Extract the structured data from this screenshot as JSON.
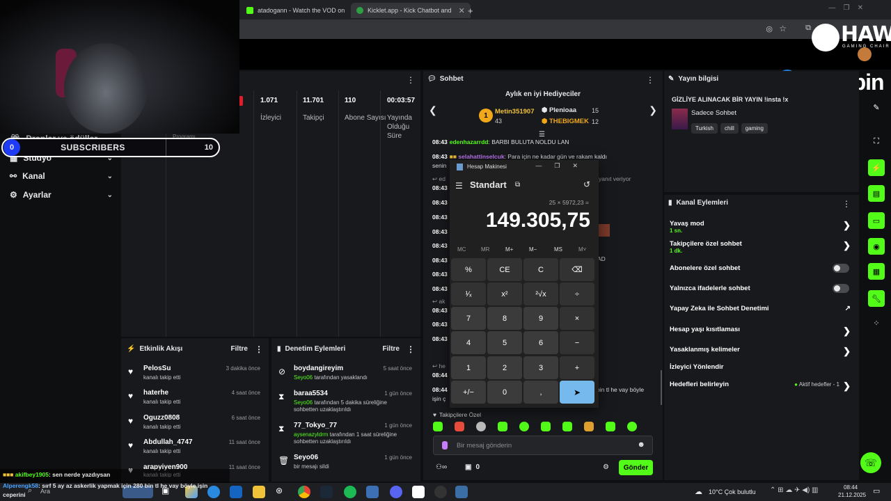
{
  "browser": {
    "tabs": [
      {
        "label": "atadogann - Watch the VOD on",
        "color": "#53fc18"
      },
      {
        "label": "Kicklet.app - Kick Chatbot and",
        "color": "#2ea043"
      }
    ],
    "new_tab": "+"
  },
  "overlay": {
    "brand_hawk": "HAWK",
    "brand_hawk_sub": "GAMING CHAIR",
    "brand_inova": "inovapin",
    "subs_count": "0",
    "subs_label": "SUBSCRIBERS",
    "subs_goal": "10"
  },
  "sidebar": {
    "items": [
      {
        "label": "Droplar ve ödüller",
        "icon": "gift-icon"
      },
      {
        "label": "Stüdyo",
        "icon": "studio-icon"
      },
      {
        "label": "Kanal",
        "icon": "channel-icon"
      },
      {
        "label": "Ayarlar",
        "icon": "gear-icon"
      }
    ],
    "program_label": "Programı"
  },
  "stats": {
    "items": [
      {
        "value": "1.071",
        "label": "İzleyici"
      },
      {
        "value": "11.701",
        "label": "Takipçi"
      },
      {
        "value": "110",
        "label": "Abone Sayısı"
      },
      {
        "value": "00:03:57",
        "label": "Yayında Olduğu Süre"
      }
    ]
  },
  "activity": {
    "title": "Etkinlik Akışı",
    "filter": "Filtre",
    "rows": [
      {
        "name": "PelosSu",
        "time": "3 dakika önce",
        "sub": "kanalı takip etti"
      },
      {
        "name": "haterhe",
        "time": "4 saat önce",
        "sub": "kanalı takip etti"
      },
      {
        "name": "Oguzz0808",
        "time": "6 saat önce",
        "sub": "kanalı takip etti"
      },
      {
        "name": "Abdullah_4747",
        "time": "11 saat önce",
        "sub": "kanalı takip etti"
      },
      {
        "name": "arapyiyen900",
        "time": "11 saat önce",
        "sub": "kanalı takip etti"
      }
    ]
  },
  "moderation": {
    "title": "Denetim Eylemleri",
    "filter": "Filtre",
    "rows": [
      {
        "name": "boydangireyim",
        "time": "5 saat önce",
        "mod": "Seyo06",
        "sub": "tarafından yasaklandı"
      },
      {
        "name": "baraa5534",
        "time": "1 gün önce",
        "mod": "Seyo06",
        "sub": "tarafından 5 dakika süreliğine sohbetten uzaklaştırıldı"
      },
      {
        "name": "77_Tokyo_77",
        "time": "1 gün önce",
        "mod": "aysenazyldrm",
        "sub": "tarafından 1 saat süreliğine sohbetten uzaklaştırıldı"
      },
      {
        "name": "Seyo06",
        "time": "1 gün önce",
        "mod": "",
        "sub": "bir mesajı sildi"
      }
    ]
  },
  "chat": {
    "title": "Sohbet",
    "gifters_title": "Aylık en iyi Hediyeciler",
    "gifters": [
      {
        "rank": "1",
        "name": "Metin351907",
        "count": "43"
      },
      {
        "name": "Plenioaa",
        "count": "15"
      },
      {
        "name": "THEBIGMEK",
        "count": "12"
      }
    ],
    "lines": [
      {
        "time": "08:43",
        "user": "edenhazarrdd",
        "text": ": BARBI BULUTA NOLDU LAN"
      },
      {
        "time": "08:43",
        "user": "selahattinselcuk",
        "text": ": Para için ne kadar gün ve rakam kaldı"
      },
      {
        "time": "",
        "user": "",
        "text": "senin"
      },
      {
        "time": "08:43",
        "user": "",
        "text": "ed"
      },
      {
        "time": "08:43",
        "user": "",
        "text": ""
      },
      {
        "time": "08:43",
        "user": "",
        "text": ""
      },
      {
        "time": "08:43",
        "user": "",
        "text": ""
      },
      {
        "time": "08:43",
        "user": "",
        "text": ""
      },
      {
        "time": "08:43",
        "user": "",
        "text": ""
      },
      {
        "time": "08:43",
        "user": "",
        "text": ""
      },
      {
        "time": "08:43",
        "user": "",
        "text": ""
      }
    ],
    "right_frag_1": "yanıt veriyor",
    "right_frag_2": "AD",
    "right_frag_3": "bin tl he vay böyle",
    "right_frag_4": "işin ç",
    "aux_times": [
      "08:43",
      "08:43",
      "08:43",
      "08:44",
      "08:44"
    ],
    "aux_labels": [
      "ak",
      "he"
    ],
    "followers_only": "Takipçilere Özel",
    "input_placeholder": "Bir mesaj gönderin",
    "points": "0",
    "send": "Gönder"
  },
  "calculator": {
    "window_title": "Hesap Makinesi",
    "mode": "Standart",
    "expression": "25 × 5972,23 =",
    "display": "149.305,75",
    "memory": [
      "MC",
      "MR",
      "M+",
      "M−",
      "MS",
      "M˅"
    ],
    "keys": [
      "%",
      "CE",
      "C",
      "⌫",
      "¹⁄ₓ",
      "x²",
      "²√x",
      "÷",
      "7",
      "8",
      "9",
      "×",
      "4",
      "5",
      "6",
      "−",
      "1",
      "2",
      "3",
      "+",
      "+/−",
      "0",
      ",",
      "="
    ]
  },
  "stream_info": {
    "title": "Yayın bilgisi",
    "stream_title": "GİZLİYE ALINACAK BİR YAYIN !insta !x",
    "category": "Sadece Sohbet",
    "tags": [
      "Turkish",
      "chill",
      "gaming"
    ]
  },
  "channel_actions": {
    "title": "Kanal Eylemleri",
    "items": [
      {
        "label": "Yavaş mod",
        "sub": "1 sn.",
        "type": "arrow"
      },
      {
        "label": "Takipçilere özel sohbet",
        "sub": "1 dk.",
        "type": "arrow"
      },
      {
        "label": "Abonelere özel sohbet",
        "sub": "",
        "type": "toggle"
      },
      {
        "label": "Yalnızca ifadelerle sohbet",
        "sub": "",
        "type": "toggle"
      },
      {
        "label": "Yapay Zeka ile Sohbet Denetimi",
        "sub": "",
        "type": "external"
      },
      {
        "label": "Hesap yaşı kısıtlaması",
        "sub": "",
        "type": "arrow"
      },
      {
        "label": "Yasaklanmış kelimeler",
        "sub": "",
        "type": "arrow"
      },
      {
        "label": "İzleyici Yönlendir",
        "sub": "",
        "type": "none"
      },
      {
        "label": "Hedefleri belirleyin",
        "sub": "",
        "type": "arrow"
      }
    ],
    "goals_badge": "Aktif hedefler - 1"
  },
  "bottom_overlay": {
    "line1_user": "akifbey1905",
    "line1_text": ": sen nerde yazdıysan",
    "line2_user": "Alperengk58",
    "line2_text": ": sırf 5 ay az askerlik yapmak için 280 bin tl he vay böyle işin",
    "line3_text": "ceperini"
  },
  "taskbar": {
    "search": "Ara",
    "weather": "10°C  Çok bulutlu",
    "time": "08:44",
    "date": "21.12.2025"
  }
}
